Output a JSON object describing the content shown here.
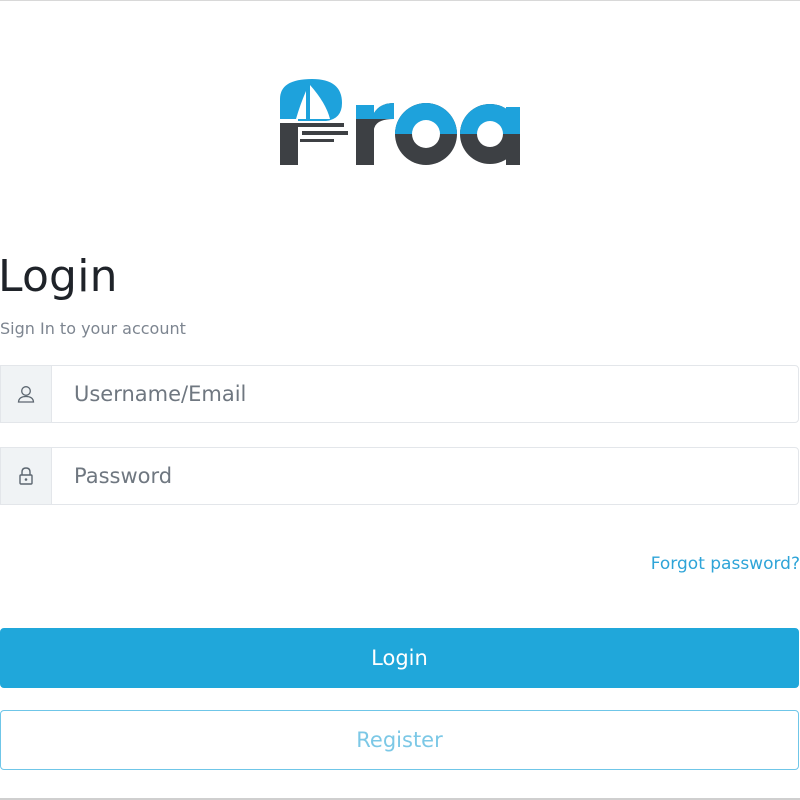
{
  "brand": {
    "logo_text": "Proa",
    "colors": {
      "blue": "#1ea2dc",
      "dark": "#3d4044"
    }
  },
  "login": {
    "title": "Login",
    "subtitle": "Sign In to your account",
    "username": {
      "placeholder": "Username/Email",
      "value": "",
      "icon": "user-icon"
    },
    "password": {
      "placeholder": "Password",
      "value": "",
      "icon": "lock-icon"
    },
    "forgot_label": "Forgot password?",
    "login_label": "Login",
    "register_label": "Register"
  },
  "colors": {
    "accent": "#20a7da",
    "link": "#2ea4d8",
    "register_text": "#7cc8e6"
  }
}
